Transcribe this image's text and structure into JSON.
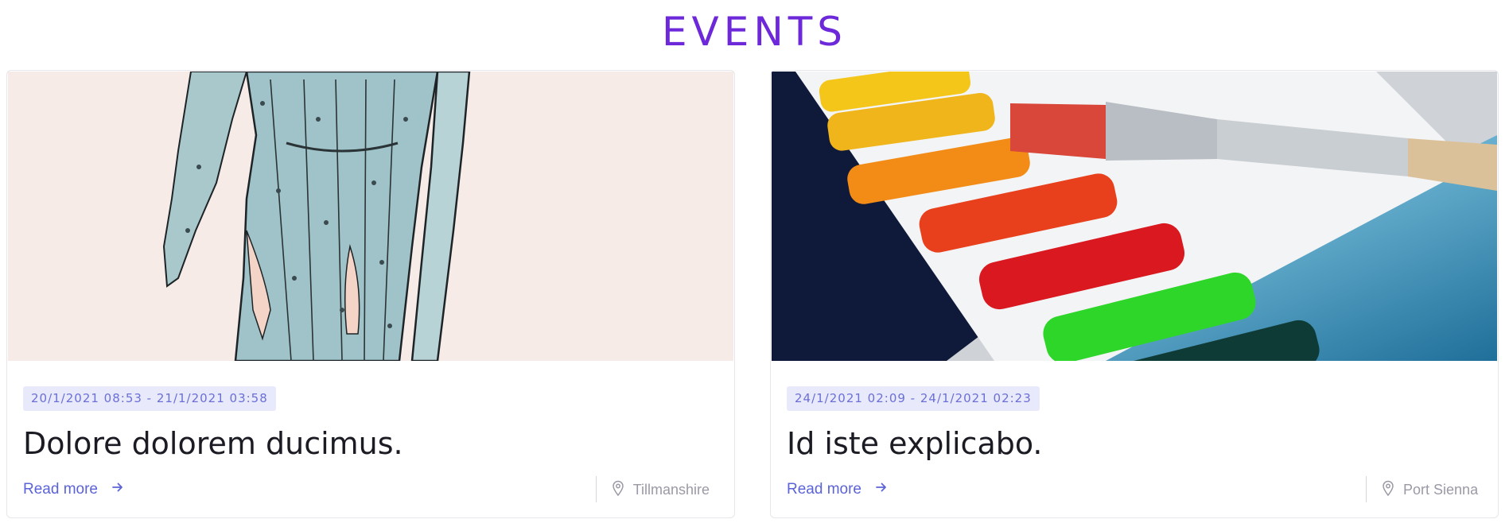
{
  "section": {
    "title": "EVENTS"
  },
  "events": [
    {
      "date_range": "20/1/2021 08:53 - 21/1/2021 03:58",
      "title": "Dolore dolorem ducimus.",
      "read_more": "Read more",
      "location": "Tillmanshire",
      "image_icon": "fashion-illustration-image"
    },
    {
      "date_range": "24/1/2021 02:09 - 24/1/2021 02:23",
      "title": "Id iste explicabo.",
      "read_more": "Read more",
      "location": "Port Sienna",
      "image_icon": "watercolor-palette-image"
    }
  ],
  "colors": {
    "accent": "#6d28d9",
    "link": "#5b63d8",
    "badge_bg": "#e8eafc",
    "badge_text": "#6b6fd6",
    "muted": "#9a9aa6"
  }
}
